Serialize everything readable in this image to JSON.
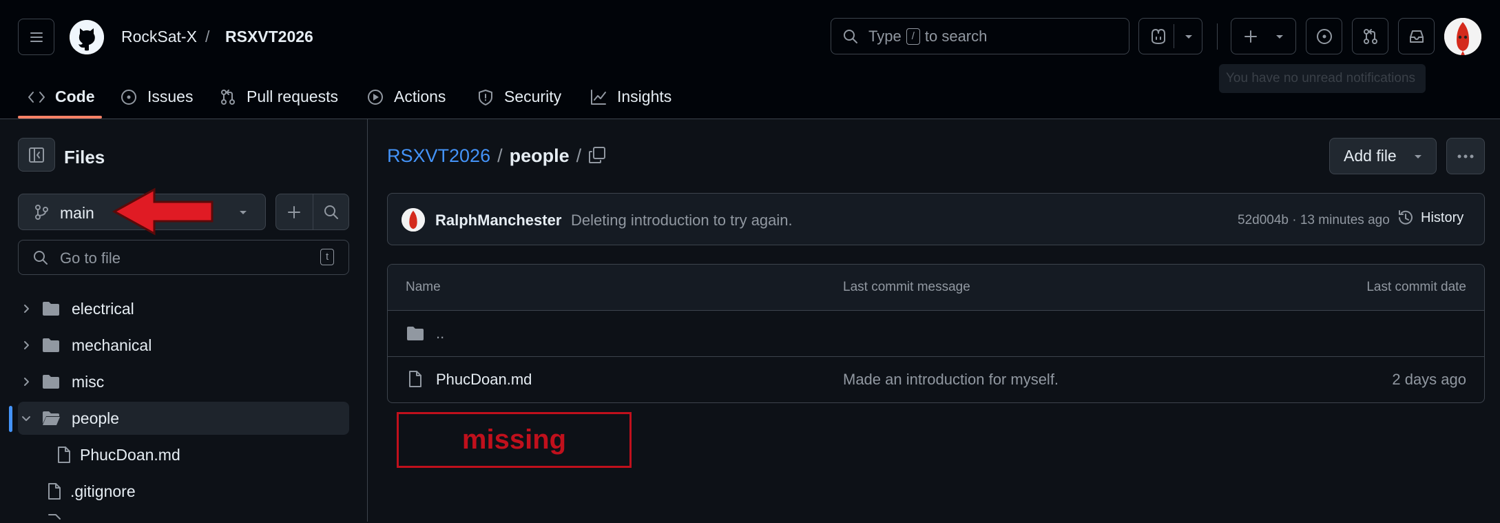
{
  "header": {
    "owner": "RockSat-X",
    "separator": "/",
    "repo": "RSXVT2026",
    "search_prefix": "Type",
    "search_key": "/",
    "search_suffix": "to search",
    "notification_tooltip": "You have no unread notifications"
  },
  "tabs": [
    {
      "label": "Code",
      "icon": "code-icon"
    },
    {
      "label": "Issues",
      "icon": "issue-icon"
    },
    {
      "label": "Pull requests",
      "icon": "pull-request-icon"
    },
    {
      "label": "Actions",
      "icon": "play-icon"
    },
    {
      "label": "Security",
      "icon": "shield-icon"
    },
    {
      "label": "Insights",
      "icon": "graph-icon"
    }
  ],
  "sidebar": {
    "title": "Files",
    "branch": "main",
    "goto_placeholder": "Go to file",
    "goto_key": "t",
    "tree": [
      {
        "label": "electrical",
        "type": "folder"
      },
      {
        "label": "mechanical",
        "type": "folder"
      },
      {
        "label": "misc",
        "type": "folder"
      },
      {
        "label": "people",
        "type": "folder-open"
      },
      {
        "label": "PhucDoan.md",
        "type": "file"
      },
      {
        "label": ".gitignore",
        "type": "file"
      }
    ]
  },
  "main": {
    "breadcrumb_repo": "RSXVT2026",
    "breadcrumb_sep1": "/",
    "breadcrumb_dir": "people",
    "breadcrumb_sep2": "/",
    "add_file_label": "Add file",
    "commit": {
      "author": "RalphManchester",
      "message": "Deleting introduction to try again.",
      "meta": "52d004b · 13 minutes ago",
      "history_label": "History"
    },
    "table": {
      "col_name": "Name",
      "col_message": "Last commit message",
      "col_date": "Last commit date",
      "parent_link": "..",
      "rows": [
        {
          "name": "PhucDoan.md",
          "message": "Made an introduction for myself.",
          "date": "2 days ago"
        }
      ]
    },
    "annotation_label": "missing"
  },
  "colors": {
    "accent_link": "#4493f8",
    "tab_underline": "#f78166",
    "annotation_red": "#c0101c",
    "arrow_red": "#e01b24"
  }
}
